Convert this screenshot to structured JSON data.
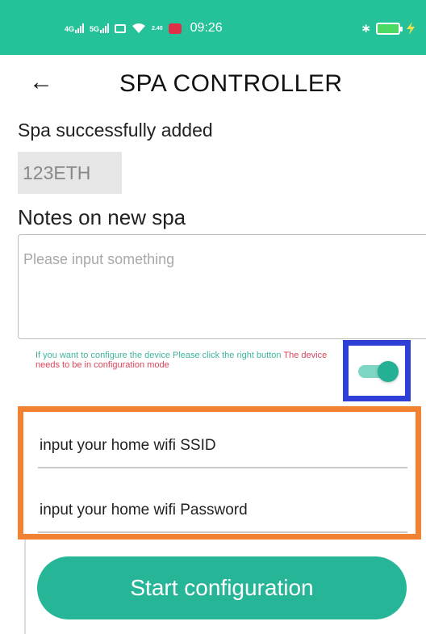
{
  "status_bar": {
    "network_1": "4G",
    "network_2": "5G",
    "speed": "2.40",
    "time": "09:26",
    "bluetooth_icon": "bluetooth-icon",
    "battery_icon": "battery-icon",
    "colors": {
      "background": "#25c29a",
      "badge": "#e03048"
    }
  },
  "header": {
    "back_icon": "arrow-left-icon",
    "back_glyph": "←",
    "title": "SPA CONTROLLER"
  },
  "main": {
    "success_message": "Spa successfully added",
    "spa_id": "123ETH",
    "notes_label": "Notes on new spa",
    "notes_input": {
      "value": "",
      "placeholder": "Please input something"
    },
    "hint_green": "If you want to configure the device Please click the right button",
    "hint_red": "The device needs to be in configuration mode",
    "config_toggle": {
      "on": true,
      "icon": "toggle-switch-icon"
    },
    "wifi_ssid": {
      "value": "",
      "placeholder": "input your home wifi SSID"
    },
    "wifi_password": {
      "value": "",
      "placeholder": "input your home wifi Password"
    },
    "start_button_label": "Start configuration"
  },
  "colors": {
    "accent": "#26b597",
    "highlight_blue": "#2e3fd6",
    "highlight_orange": "#f08232",
    "hint_red": "#d8455a"
  }
}
